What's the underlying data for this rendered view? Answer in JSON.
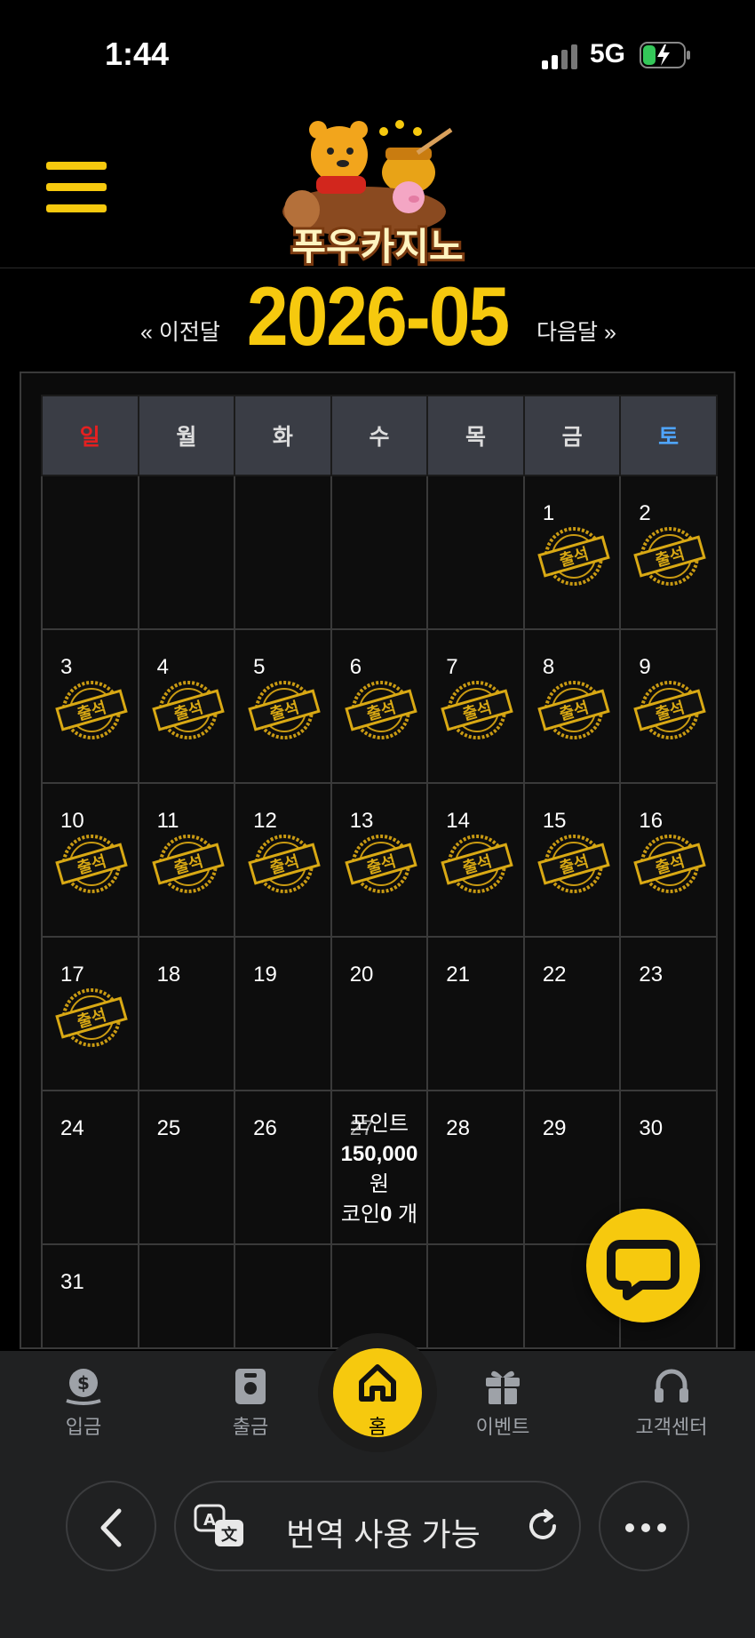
{
  "status_bar": {
    "time": "1:44",
    "network": "5G"
  },
  "header": {
    "logo_text": "푸우카지노"
  },
  "month_nav": {
    "prev_label": "« 이전달",
    "current_month": "2026-05",
    "next_label": "다음달 »"
  },
  "calendar": {
    "weekdays": [
      "일",
      "월",
      "화",
      "수",
      "목",
      "금",
      "토"
    ],
    "stamp_text": "출석",
    "weeks": [
      [
        "",
        "",
        "",
        "",
        "",
        "1",
        "2"
      ],
      [
        "3",
        "4",
        "5",
        "6",
        "7",
        "8",
        "9"
      ],
      [
        "10",
        "11",
        "12",
        "13",
        "14",
        "15",
        "16"
      ],
      [
        "17",
        "18",
        "19",
        "20",
        "21",
        "22",
        "23"
      ],
      [
        "24",
        "25",
        "26",
        "27",
        "28",
        "29",
        "30"
      ],
      [
        "31",
        "",
        "",
        "",
        "",
        "",
        ""
      ]
    ],
    "attended_days": [
      "1",
      "2",
      "3",
      "4",
      "5",
      "6",
      "7",
      "8",
      "9",
      "10",
      "11",
      "12",
      "13",
      "14",
      "15",
      "16",
      "17"
    ],
    "point_summary": {
      "line1": "포인트",
      "amount": "150,000",
      "line2": "원",
      "coin_prefix": "코인",
      "coin_count": "0",
      "coin_suffix": " 개"
    }
  },
  "bottom_nav": {
    "items": [
      {
        "label": "입금",
        "icon": "money-bag-icon"
      },
      {
        "label": "출금",
        "icon": "safe-icon"
      },
      {
        "label": "홈",
        "icon": "home-icon"
      },
      {
        "label": "이벤트",
        "icon": "gift-icon"
      },
      {
        "label": "고객센터",
        "icon": "headset-icon"
      }
    ]
  },
  "browser_bar": {
    "translate_label": "번역 사용 가능"
  },
  "colors": {
    "accent": "#f6c90e",
    "sunday": "#e52020",
    "saturday": "#4fa5ff",
    "background": "#000000"
  }
}
